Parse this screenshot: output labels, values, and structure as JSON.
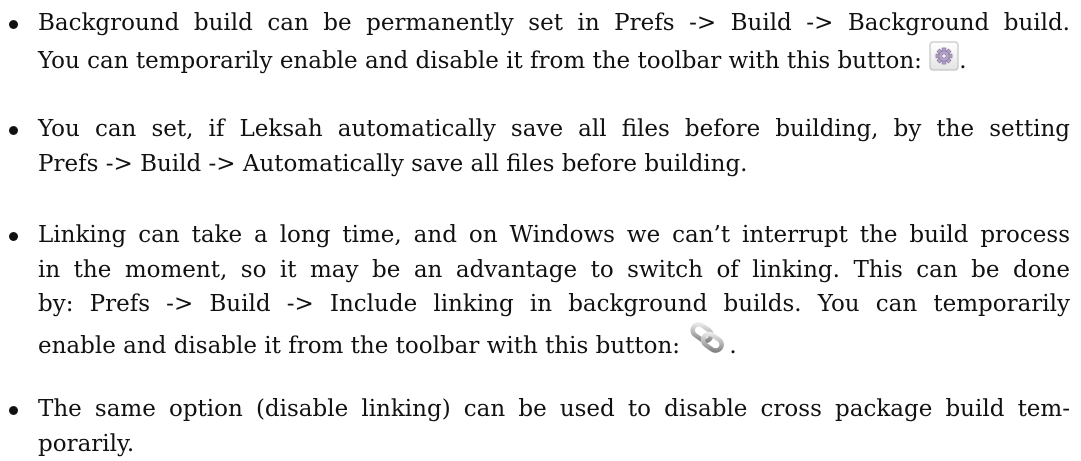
{
  "items": [
    {
      "lines": [
        "Background build can be permanently set in Prefs -> Build -> Background build.",
        "You can temporarily enable and disable it from the toolbar with this button:"
      ],
      "after_icon": ".",
      "icon": "gear-button-icon"
    },
    {
      "lines": [
        "You can set, if Leksah automatically save all files before building, by the setting",
        "Prefs -> Build -> Automatically save all files before building."
      ]
    },
    {
      "lines": [
        "Linking can take a long time, and on Windows we can’t interrupt the build process",
        "in the moment, so it may be an advantage to switch of linking. This can be done",
        "by: Prefs -> Build -> Include linking in background builds. You can temporarily",
        "enable and disable it from the toolbar with this button:"
      ],
      "after_icon": ".",
      "icon": "chain-link-icon"
    },
    {
      "lines": [
        "The same option (disable linking) can be used to disable cross package build tem-",
        "porarily."
      ]
    }
  ]
}
